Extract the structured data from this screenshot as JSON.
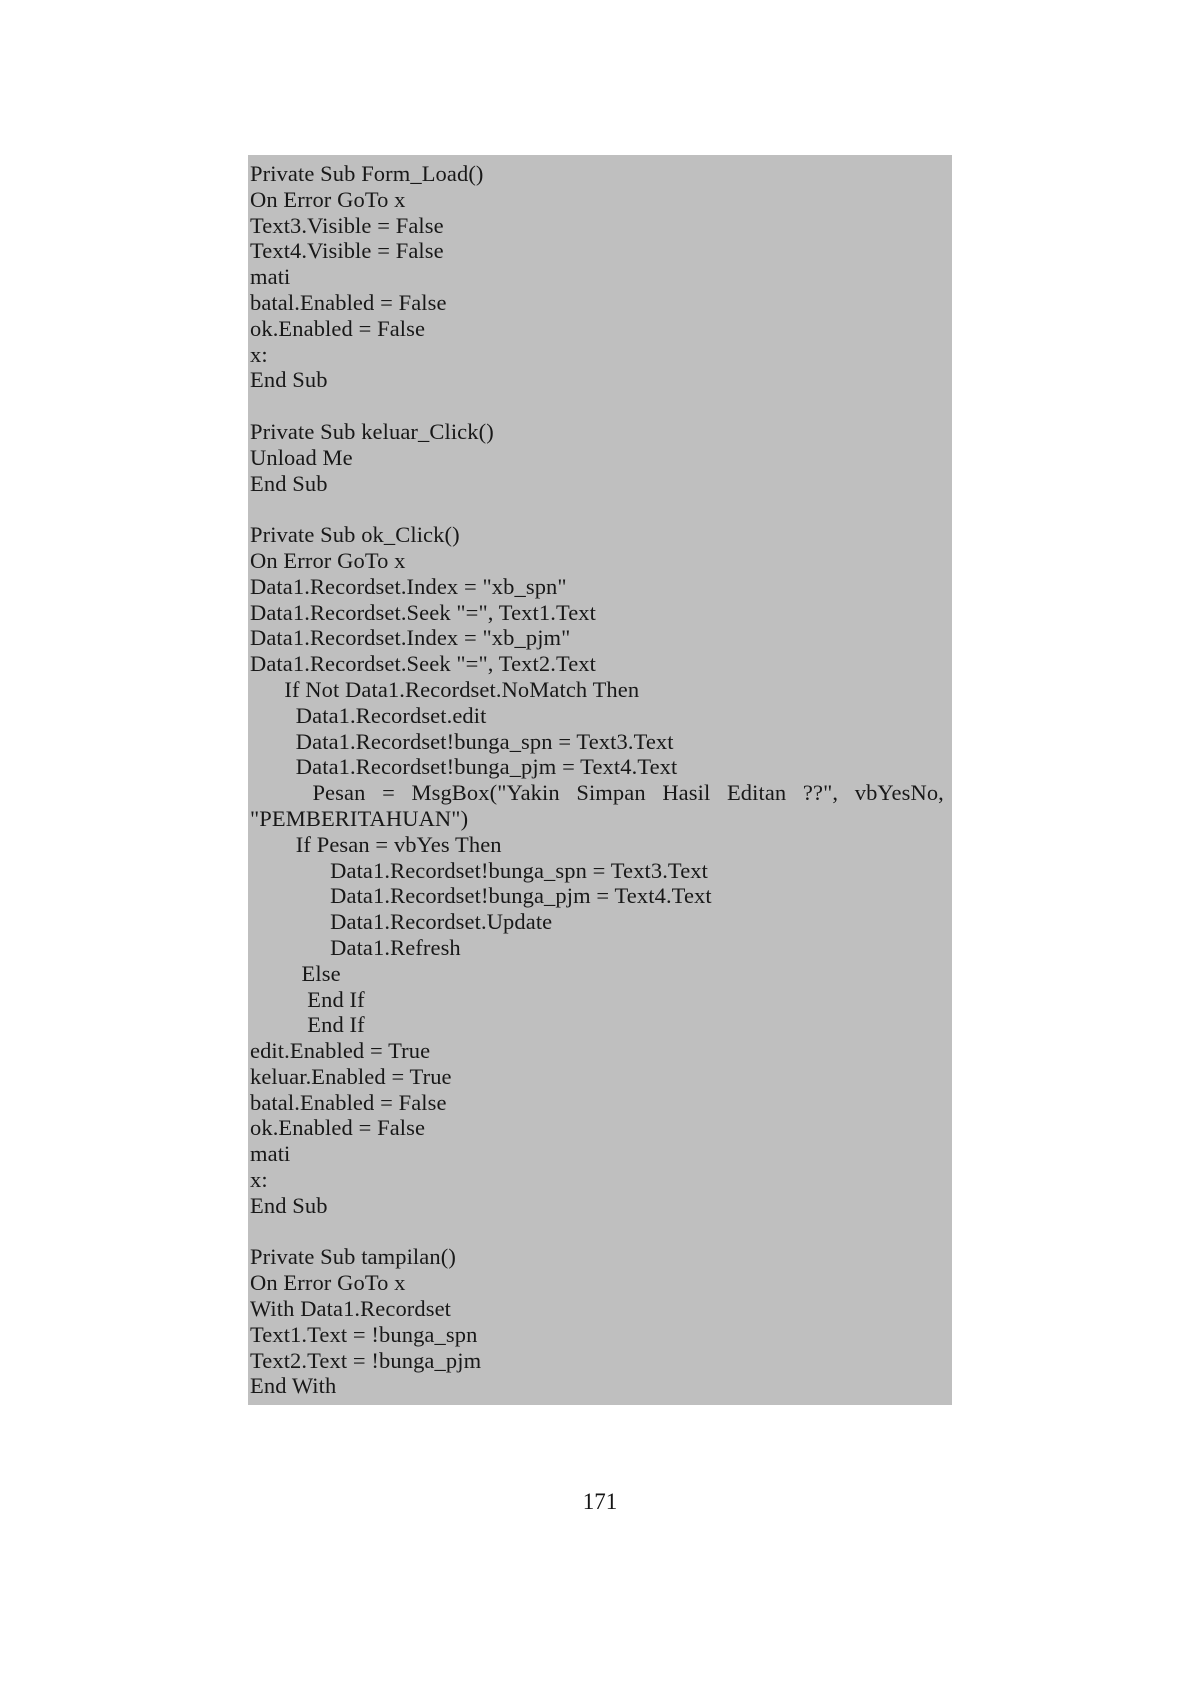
{
  "document": {
    "page_number": "171",
    "highlight_color": "#bfbfbf",
    "background_color": "#ffffff",
    "text_color": "#181818"
  },
  "code_block": {
    "language": "Visual Basic",
    "lines": [
      "Private Sub Form_Load()",
      "On Error GoTo x",
      "Text3.Visible = False",
      "Text4.Visible = False",
      "mati",
      "batal.Enabled = False",
      "ok.Enabled = False",
      "x:",
      "End Sub",
      "",
      "Private Sub keluar_Click()",
      "Unload Me",
      "End Sub",
      "",
      "Private Sub ok_Click()",
      "On Error GoTo x",
      "Data1.Recordset.Index = \"xb_spn\"",
      "Data1.Recordset.Seek \"=\", Text1.Text",
      "Data1.Recordset.Index = \"xb_pjm\"",
      "Data1.Recordset.Seek \"=\", Text2.Text",
      "      If Not Data1.Recordset.NoMatch Then",
      "        Data1.Recordset.edit",
      "        Data1.Recordset!bunga_spn = Text3.Text",
      "        Data1.Recordset!bunga_pjm = Text4.Text",
      "__JUSTIFIED__",
      "\"PEMBERITAHUAN\")",
      "        If Pesan = vbYes Then",
      "              Data1.Recordset!bunga_spn = Text3.Text",
      "              Data1.Recordset!bunga_pjm = Text4.Text",
      "              Data1.Recordset.Update",
      "              Data1.Refresh",
      "         Else",
      "          End If",
      "          End If",
      "edit.Enabled = True",
      "keluar.Enabled = True",
      "batal.Enabled = False",
      "ok.Enabled = False",
      "mati",
      "x:",
      "End Sub",
      "",
      "Private Sub tampilan()",
      "On Error GoTo x",
      "With Data1.Recordset",
      "Text1.Text = !bunga_spn",
      "Text2.Text = !bunga_pjm",
      "End With"
    ],
    "justified_line": {
      "full_text": "        Pesan = MsgBox(\"Yakin Simpan Hasil Editan ??\", vbYesNo,",
      "lead_indent": "        ",
      "words": [
        "Pesan",
        "=",
        "MsgBox(\"Yakin",
        "Simpan",
        "Hasil",
        "Editan",
        "??\",",
        "vbYesNo,"
      ]
    }
  }
}
